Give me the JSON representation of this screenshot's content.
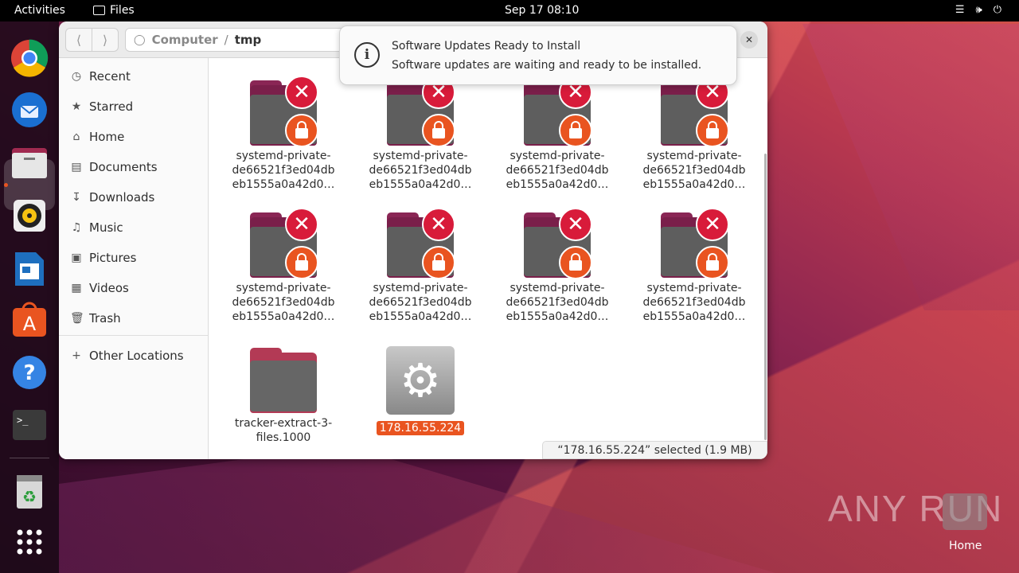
{
  "topbar": {
    "activities": "Activities",
    "app_name": "Files",
    "clock": "Sep 17  08:10",
    "icons": [
      "network-icon",
      "volume-icon",
      "power-icon"
    ]
  },
  "dock": {
    "items": [
      "chrome-icon",
      "thunderbird-icon",
      "files-icon",
      "rhythmbox-icon",
      "writer-icon",
      "app-center-icon",
      "help-icon",
      "terminal-icon",
      "trash-icon",
      "app-grid-icon"
    ]
  },
  "window": {
    "path": {
      "root": "Computer",
      "separator": "/",
      "current": "tmp"
    },
    "sidebar": {
      "items": [
        {
          "label": "Recent",
          "icon": "clock-icon"
        },
        {
          "label": "Starred",
          "icon": "star-icon"
        },
        {
          "label": "Home",
          "icon": "home-icon"
        },
        {
          "label": "Documents",
          "icon": "document-icon"
        },
        {
          "label": "Downloads",
          "icon": "download-icon"
        },
        {
          "label": "Music",
          "icon": "music-icon"
        },
        {
          "label": "Pictures",
          "icon": "picture-icon"
        },
        {
          "label": "Videos",
          "icon": "video-icon"
        },
        {
          "label": "Trash",
          "icon": "trash-icon"
        }
      ],
      "other_locations": "Other Locations"
    },
    "files": [
      {
        "line1": "systemd-private-",
        "line2": "de66521f3ed04db",
        "line3": "eb1555a0a42d0…"
      },
      {
        "line1": "systemd-private-",
        "line2": "de66521f3ed04db",
        "line3": "eb1555a0a42d0…"
      },
      {
        "line1": "systemd-private-",
        "line2": "de66521f3ed04db",
        "line3": "eb1555a0a42d0…"
      },
      {
        "line1": "systemd-private-",
        "line2": "de66521f3ed04db",
        "line3": "eb1555a0a42d0…"
      },
      {
        "line1": "systemd-private-",
        "line2": "de66521f3ed04db",
        "line3": "eb1555a0a42d0…"
      },
      {
        "line1": "systemd-private-",
        "line2": "de66521f3ed04db",
        "line3": "eb1555a0a42d0…"
      },
      {
        "line1": "systemd-private-",
        "line2": "de66521f3ed04db",
        "line3": "eb1555a0a42d0…"
      },
      {
        "line1": "systemd-private-",
        "line2": "de66521f3ed04db",
        "line3": "eb1555a0a42d0…"
      },
      {
        "line1": "tracker-extract-3-",
        "line2": "files.1000"
      },
      {
        "line1": "178.16.55.224",
        "selected": true
      }
    ],
    "status": "“178.16.55.224” selected  (1.9 MB)"
  },
  "notification": {
    "title": "Software Updates Ready to Install",
    "body": "Software updates are waiting and ready to be installed."
  },
  "desktop": {
    "watermark": "ANY RUN",
    "home_label": "Home"
  },
  "colors": {
    "accent": "#e95420",
    "error": "#d81b3a"
  }
}
